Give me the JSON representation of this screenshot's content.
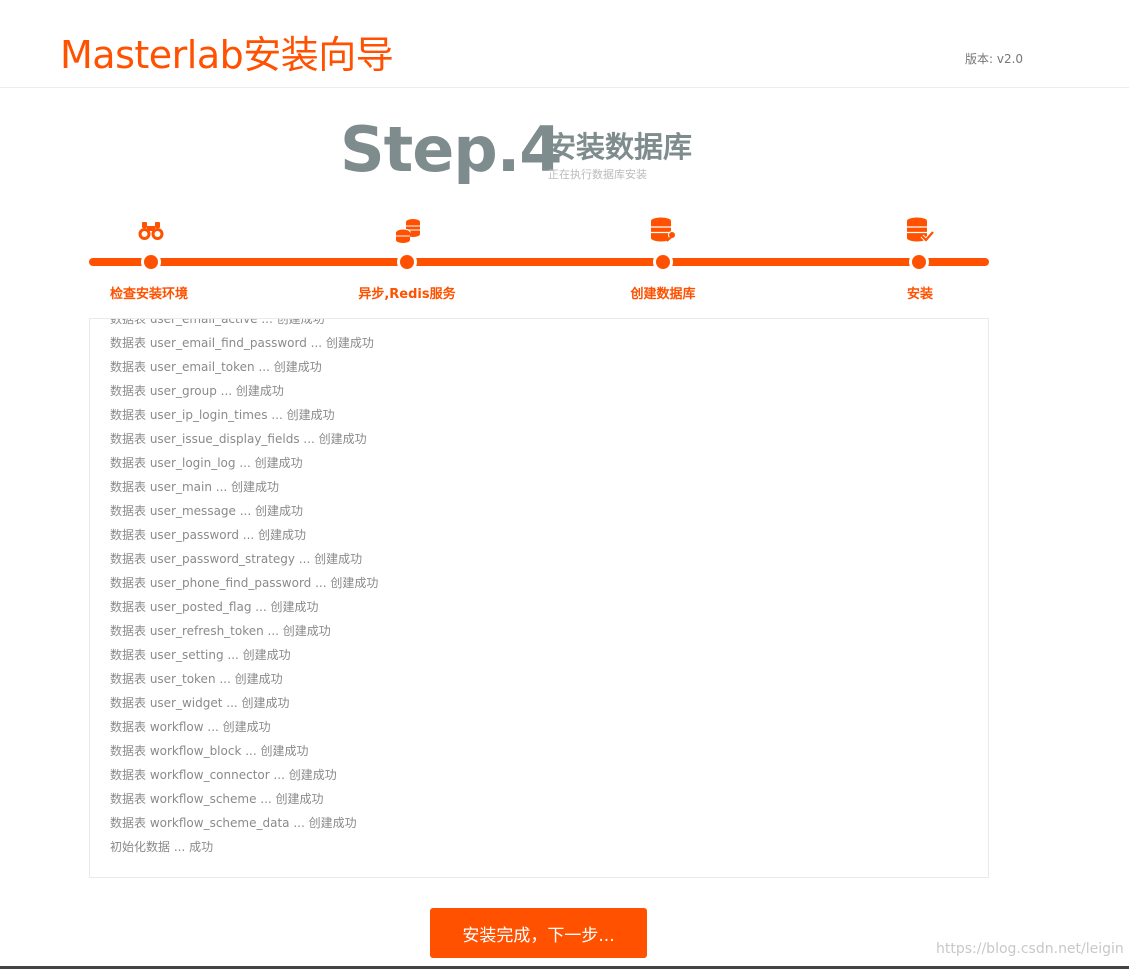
{
  "header": {
    "brand": "Masterlab安装向导",
    "version": "版本: v2.0"
  },
  "step": {
    "number": "Step.4",
    "title": "安装数据库",
    "subtitle": "正在执行数据库安装"
  },
  "stages": [
    {
      "label": "检查安装环境",
      "icon": "binoculars-icon"
    },
    {
      "label": "异步,Redis服务",
      "icon": "coins-stack-icon"
    },
    {
      "label": "创建数据库",
      "icon": "database-key-icon"
    },
    {
      "label": "安装",
      "icon": "database-check-icon"
    }
  ],
  "log": [
    "数据表 user_email_active ... 创建成功",
    "数据表 user_email_find_password ... 创建成功",
    "数据表 user_email_token ... 创建成功",
    "数据表 user_group ... 创建成功",
    "数据表 user_ip_login_times ... 创建成功",
    "数据表 user_issue_display_fields ... 创建成功",
    "数据表 user_login_log ... 创建成功",
    "数据表 user_main ... 创建成功",
    "数据表 user_message ... 创建成功",
    "数据表 user_password ... 创建成功",
    "数据表 user_password_strategy ... 创建成功",
    "数据表 user_phone_find_password ... 创建成功",
    "数据表 user_posted_flag ... 创建成功",
    "数据表 user_refresh_token ... 创建成功",
    "数据表 user_setting ... 创建成功",
    "数据表 user_token ... 创建成功",
    "数据表 user_widget ... 创建成功",
    "数据表 workflow ... 创建成功",
    "数据表 workflow_block ... 创建成功",
    "数据表 workflow_connector ... 创建成功",
    "数据表 workflow_scheme ... 创建成功",
    "数据表 workflow_scheme_data ... 创建成功",
    "初始化数据 ... 成功"
  ],
  "next_button": "安装完成，下一步...",
  "watermark": "https://blog.csdn.net/leigin",
  "colors": {
    "accent": "#ff5100",
    "step_gray": "#7f8c8d"
  }
}
